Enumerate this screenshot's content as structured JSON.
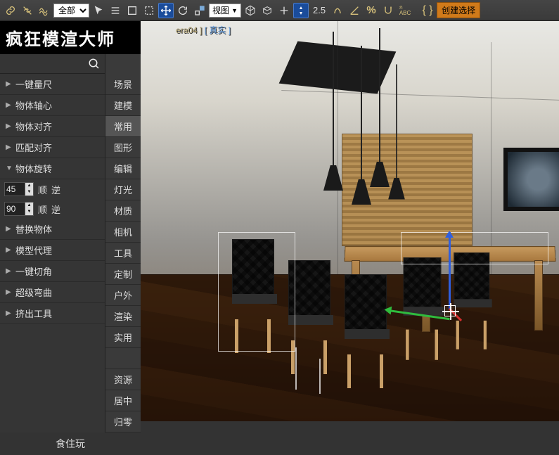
{
  "toolbar": {
    "filter_dropdown": "全部",
    "view_dropdown": "视图",
    "value": "2.5",
    "percent_icon": "%",
    "create_btn": "创建选择"
  },
  "brand": "疯狂模渲大师",
  "sidebar": {
    "tools": [
      {
        "label": "一键量尺",
        "expanded": false
      },
      {
        "label": "物体轴心",
        "expanded": false
      },
      {
        "label": "物体对齐",
        "expanded": false
      },
      {
        "label": "匹配对齐",
        "expanded": false
      },
      {
        "label": "物体旋转",
        "expanded": true
      }
    ],
    "rotate": {
      "val1": "45",
      "val2": "90",
      "cw": "顺",
      "ccw": "逆"
    },
    "tools2": [
      {
        "label": "替换物体"
      },
      {
        "label": "模型代理"
      },
      {
        "label": "一键切角"
      },
      {
        "label": "超级弯曲"
      },
      {
        "label": "挤出工具"
      }
    ],
    "categories": [
      "场景",
      "建模",
      "常用",
      "图形",
      "编辑",
      "灯光",
      "材质",
      "相机",
      "工具",
      "定制",
      "户外",
      "渲染",
      "实用",
      "",
      "资源",
      "居中",
      "归零"
    ],
    "active_category": "常用",
    "bottom_link": "食住玩"
  },
  "viewport": {
    "cam_label": "era04 ]",
    "mode_label": "[ 真实 ]"
  }
}
